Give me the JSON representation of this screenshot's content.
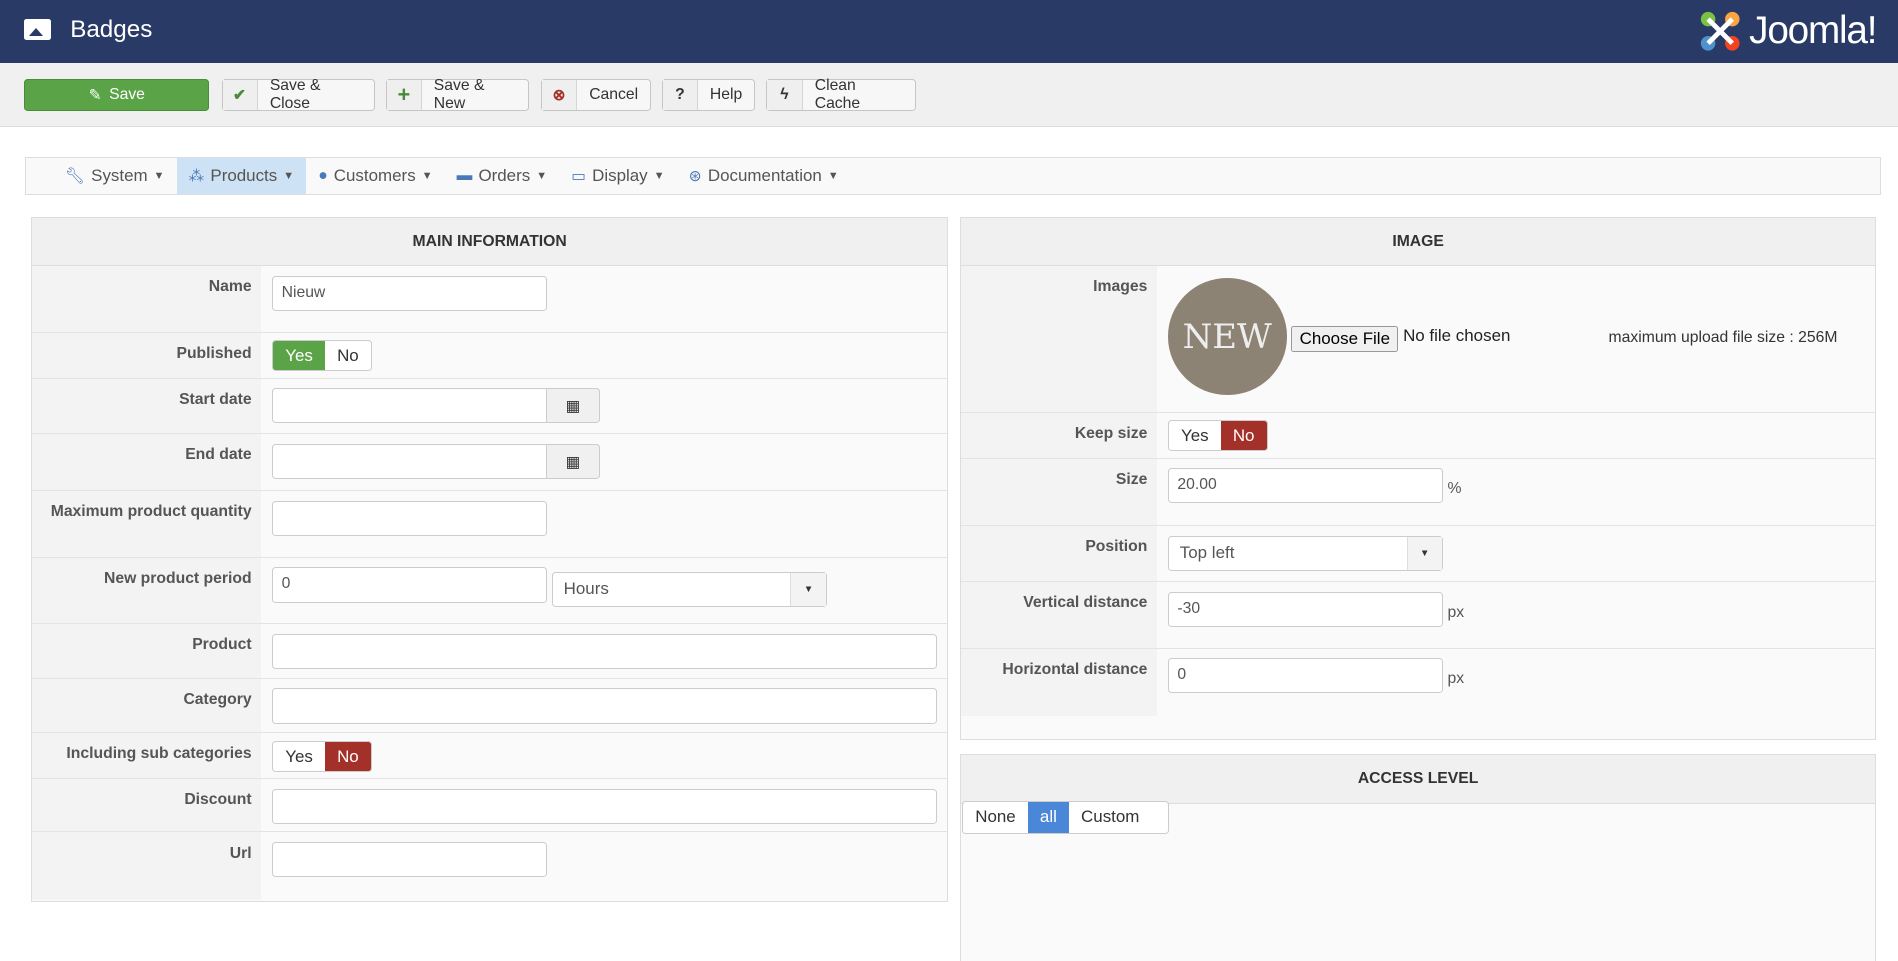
{
  "header": {
    "title": "Badges",
    "logo_text": "Joomla!"
  },
  "toolbar": {
    "save": "Save",
    "save_close": "Save & Close",
    "save_new": "Save & New",
    "cancel": "Cancel",
    "help": "Help",
    "clean_cache": "Clean Cache"
  },
  "nav": [
    {
      "label": "System"
    },
    {
      "label": "Products"
    },
    {
      "label": "Customers"
    },
    {
      "label": "Orders"
    },
    {
      "label": "Display"
    },
    {
      "label": "Documentation"
    }
  ],
  "main": {
    "title": "MAIN INFORMATION",
    "name_label": "Name",
    "name_value": "Nieuw",
    "published_label": "Published",
    "yes": "Yes",
    "no": "No",
    "start_label": "Start date",
    "end_label": "End date",
    "maxqty_label": "Maximum product quantity",
    "period_label": "New product period",
    "period_value": "0",
    "period_unit": "Hours",
    "product_label": "Product",
    "category_label": "Category",
    "subcat_label": "Including sub categories",
    "discount_label": "Discount",
    "url_label": "Url"
  },
  "image": {
    "title": "IMAGE",
    "images_label": "Images",
    "badge_text": "NEW",
    "choose_file": "Choose File",
    "no_file": "No file chosen",
    "max_upload": "maximum upload file size : 256M",
    "keep_label": "Keep size",
    "yes": "Yes",
    "no": "No",
    "size_label": "Size",
    "size_value": "20.00",
    "size_unit": "%",
    "position_label": "Position",
    "position_value": "Top left",
    "vertical_label": "Vertical distance",
    "vertical_value": "-30",
    "horizontal_label": "Horizontal distance",
    "horizontal_value": "0",
    "px": "px"
  },
  "access": {
    "title": "ACCESS LEVEL",
    "none": "None",
    "all": "all",
    "custom": "Custom"
  }
}
